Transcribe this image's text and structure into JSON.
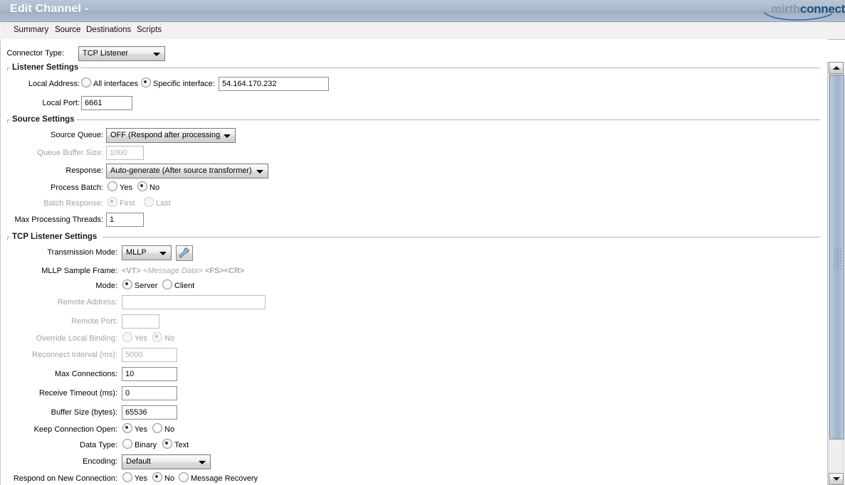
{
  "window": {
    "title": "Edit Channel -",
    "logo_mirth": "mirth",
    "logo_connect": "connect"
  },
  "tabs": [
    {
      "label": "Summary",
      "selected": false
    },
    {
      "label": "Source",
      "selected": true
    },
    {
      "label": "Destinations",
      "selected": false
    },
    {
      "label": "Scripts",
      "selected": false
    }
  ],
  "connector": {
    "label": "Connector Type:",
    "value": "TCP Listener"
  },
  "listener_settings": {
    "title": "Listener Settings",
    "local_address": {
      "label": "Local Address:",
      "option_all": "All interfaces",
      "option_specific": "Specific interface:",
      "selected": "specific",
      "value": "54.164.170.232"
    },
    "local_port": {
      "label": "Local Port:",
      "value": "6661"
    }
  },
  "source_settings": {
    "title": "Source Settings",
    "source_queue": {
      "label": "Source Queue:",
      "value": "OFF (Respond after processing)"
    },
    "queue_buffer_size": {
      "label": "Queue Buffer Size:",
      "value": "1000",
      "disabled": true
    },
    "response": {
      "label": "Response:",
      "value": "Auto-generate (After source transformer)"
    },
    "process_batch": {
      "label": "Process Batch:",
      "option_yes": "Yes",
      "option_no": "No",
      "selected": "No"
    },
    "batch_response": {
      "label": "Batch Response:",
      "option_first": "First",
      "option_last": "Last",
      "selected": "First",
      "disabled": true
    },
    "max_processing_threads": {
      "label": "Max Processing Threads:",
      "value": "1"
    }
  },
  "tcp_listener_settings": {
    "title": "TCP Listener Settings",
    "transmission_mode": {
      "label": "Transmission Mode:",
      "value": "MLLP",
      "settings_icon": "wrench-icon"
    },
    "mllp_sample_frame": {
      "label": "MLLP Sample Frame:",
      "part1": "<VT>",
      "part2": "<Message Data>",
      "part3": "<FS><CR>"
    },
    "mode": {
      "label": "Mode:",
      "option_server": "Server",
      "option_client": "Client",
      "selected": "Server"
    },
    "remote_address": {
      "label": "Remote Address:",
      "value": "",
      "disabled": true
    },
    "remote_port": {
      "label": "Remote Port:",
      "value": "",
      "disabled": true
    },
    "override_local_binding": {
      "label": "Override Local Binding:",
      "option_yes": "Yes",
      "option_no": "No",
      "selected": "No",
      "disabled": true
    },
    "reconnect_interval": {
      "label": "Reconnect Interval (ms):",
      "value": "5000",
      "disabled": true
    },
    "max_connections": {
      "label": "Max Connections:",
      "value": "10"
    },
    "receive_timeout": {
      "label": "Receive Timeout (ms):",
      "value": "0"
    },
    "buffer_size": {
      "label": "Buffer Size (bytes):",
      "value": "65536"
    },
    "keep_connection_open": {
      "label": "Keep Connection Open:",
      "option_yes": "Yes",
      "option_no": "No",
      "selected": "Yes"
    },
    "data_type": {
      "label": "Data Type:",
      "option_binary": "Binary",
      "option_text": "Text",
      "selected": "Text"
    },
    "encoding": {
      "label": "Encoding:",
      "value": "Default"
    },
    "respond_on_new_connection": {
      "label": "Respond on New Connection:",
      "option_yes": "Yes",
      "option_no": "No",
      "option_recovery": "Message Recovery",
      "selected": "No"
    }
  },
  "colors": {
    "titlebar": "#aab9cb",
    "accent": "#1f4e79",
    "scroll_thumb": "#a9bad0"
  }
}
